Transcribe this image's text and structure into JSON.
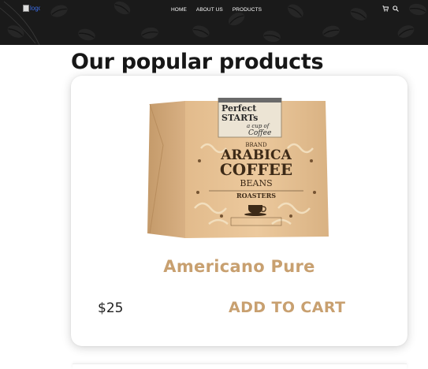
{
  "header": {
    "logo_alt": "logo",
    "logo_icon": "broken-image-icon",
    "background_color": "#1a1a1a",
    "nav_items": [
      {
        "label": "HOME"
      },
      {
        "label": "ABOUT US"
      },
      {
        "label": "PRODUCTS"
      }
    ],
    "icons": [
      "cart-icon",
      "search-icon"
    ]
  },
  "section": {
    "title": "Our popular products"
  },
  "product": {
    "name": "Americano Pure",
    "price": "$25",
    "add_to_cart_label": "ADD TO CART",
    "accent_color": "#c8a070",
    "image": {
      "tag_line1": "Perfect",
      "tag_line2": "STARTs",
      "tag_line3": "a cup of",
      "tag_line4": "Coffee",
      "brand": "BRAND",
      "title_line1": "ARABICA",
      "title_line2": "COFFEE",
      "title_line3": "BEANS",
      "subtitle": "ROASTERS"
    }
  }
}
